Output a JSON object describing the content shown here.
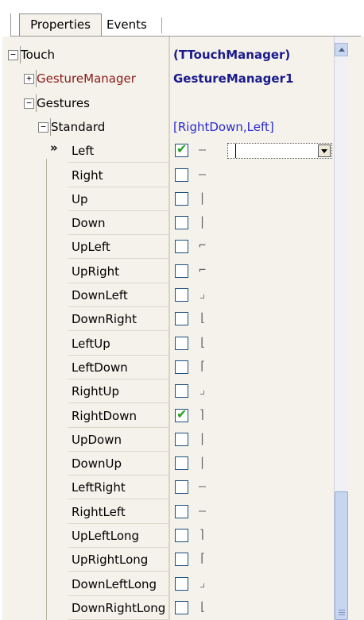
{
  "tabs": {
    "properties": "Properties",
    "events": "Events"
  },
  "rows": [
    {
      "name": "Touch",
      "value": "(TTouchManager)",
      "level": 0,
      "expander": "−"
    },
    {
      "name": "GestureManager",
      "value": "GestureManager1",
      "level": 1,
      "expander": "+"
    },
    {
      "name": "Gestures",
      "value": "",
      "level": 1,
      "expander": "−"
    },
    {
      "name": "Standard",
      "value": "[RightDown,Left]",
      "level": 2,
      "expander": "−"
    },
    {
      "name": "Left",
      "checked": true,
      "glyph": "—",
      "selected": true
    },
    {
      "name": "Right",
      "checked": false,
      "glyph": "—"
    },
    {
      "name": "Up",
      "checked": false,
      "glyph": "|"
    },
    {
      "name": "Down",
      "checked": false,
      "glyph": "|"
    },
    {
      "name": "UpLeft",
      "checked": false,
      "glyph": "⌐"
    },
    {
      "name": "UpRight",
      "checked": false,
      "glyph": "⌐"
    },
    {
      "name": "DownLeft",
      "checked": false,
      "glyph": "⌟"
    },
    {
      "name": "DownRight",
      "checked": false,
      "glyph": "⌊"
    },
    {
      "name": "LeftUp",
      "checked": false,
      "glyph": "⌊"
    },
    {
      "name": "LeftDown",
      "checked": false,
      "glyph": "⌈"
    },
    {
      "name": "RightUp",
      "checked": false,
      "glyph": "⌟"
    },
    {
      "name": "RightDown",
      "checked": true,
      "glyph": "⌉"
    },
    {
      "name": "UpDown",
      "checked": false,
      "glyph": "|"
    },
    {
      "name": "DownUp",
      "checked": false,
      "glyph": "|"
    },
    {
      "name": "LeftRight",
      "checked": false,
      "glyph": "—"
    },
    {
      "name": "RightLeft",
      "checked": false,
      "glyph": "—"
    },
    {
      "name": "UpLeftLong",
      "checked": false,
      "glyph": "⌉"
    },
    {
      "name": "UpRightLong",
      "checked": false,
      "glyph": "⌈"
    },
    {
      "name": "DownLeftLong",
      "checked": false,
      "glyph": "⌟"
    },
    {
      "name": "DownRightLong",
      "checked": false,
      "glyph": "⌊"
    }
  ],
  "selection_marker": "»",
  "colors": {
    "header_blue": "#1a1a8c",
    "manager_red": "#8b1a1a",
    "value_blue": "#2a2ad0",
    "check_green": "#21a121"
  }
}
